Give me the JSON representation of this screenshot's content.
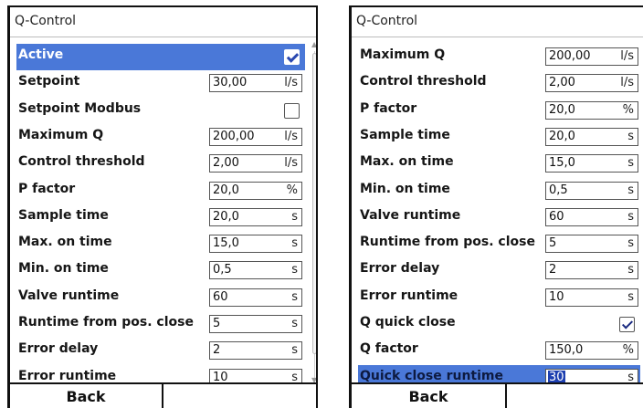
{
  "left_panel": {
    "title": "Q-Control",
    "rows": [
      {
        "label": "Active",
        "type": "checkbox",
        "checked": true,
        "selected": true
      },
      {
        "label": "Setpoint",
        "type": "field",
        "value": "30,00",
        "unit": "l/s"
      },
      {
        "label": "Setpoint Modbus",
        "type": "checkbox",
        "checked": false
      },
      {
        "label": "Maximum Q",
        "type": "field",
        "value": "200,00",
        "unit": "l/s"
      },
      {
        "label": "Control threshold",
        "type": "field",
        "value": "2,00",
        "unit": "l/s"
      },
      {
        "label": "P factor",
        "type": "field",
        "value": "20,0",
        "unit": "%"
      },
      {
        "label": "Sample time",
        "type": "field",
        "value": "20,0",
        "unit": "s"
      },
      {
        "label": "Max. on time",
        "type": "field",
        "value": "15,0",
        "unit": "s"
      },
      {
        "label": "Min. on time",
        "type": "field",
        "value": "0,5",
        "unit": "s"
      },
      {
        "label": "Valve runtime",
        "type": "field",
        "value": "60",
        "unit": "s"
      },
      {
        "label": "Runtime from pos. close",
        "type": "field",
        "value": "5",
        "unit": "s"
      },
      {
        "label": "Error delay",
        "type": "field",
        "value": "2",
        "unit": "s"
      },
      {
        "label": "Error runtime",
        "type": "field",
        "value": "10",
        "unit": "s"
      }
    ],
    "softkeys": [
      "Back",
      ""
    ]
  },
  "right_panel": {
    "title": "Q-Control",
    "rows": [
      {
        "label": "Maximum Q",
        "type": "field",
        "value": "200,00",
        "unit": "l/s"
      },
      {
        "label": "Control threshold",
        "type": "field",
        "value": "2,00",
        "unit": "l/s"
      },
      {
        "label": "P factor",
        "type": "field",
        "value": "20,0",
        "unit": "%"
      },
      {
        "label": "Sample time",
        "type": "field",
        "value": "20,0",
        "unit": "s"
      },
      {
        "label": "Max. on time",
        "type": "field",
        "value": "15,0",
        "unit": "s"
      },
      {
        "label": "Min. on time",
        "type": "field",
        "value": "0,5",
        "unit": "s"
      },
      {
        "label": "Valve runtime",
        "type": "field",
        "value": "60",
        "unit": "s"
      },
      {
        "label": "Runtime from pos. close",
        "type": "field",
        "value": "5",
        "unit": "s"
      },
      {
        "label": "Error delay",
        "type": "field",
        "value": "2",
        "unit": "s"
      },
      {
        "label": "Error runtime",
        "type": "field",
        "value": "10",
        "unit": "s"
      },
      {
        "label": "Q quick close",
        "type": "checkbox",
        "checked": true
      },
      {
        "label": "Q factor",
        "type": "field",
        "value": "150,0",
        "unit": "%"
      },
      {
        "label": "Quick close runtime",
        "type": "field",
        "value": "30",
        "unit": "s",
        "selected": true
      }
    ],
    "softkeys": [
      "Back",
      ""
    ]
  },
  "colors": {
    "selection": "#4a78d8",
    "text_highlight": "#1d3fb0"
  }
}
